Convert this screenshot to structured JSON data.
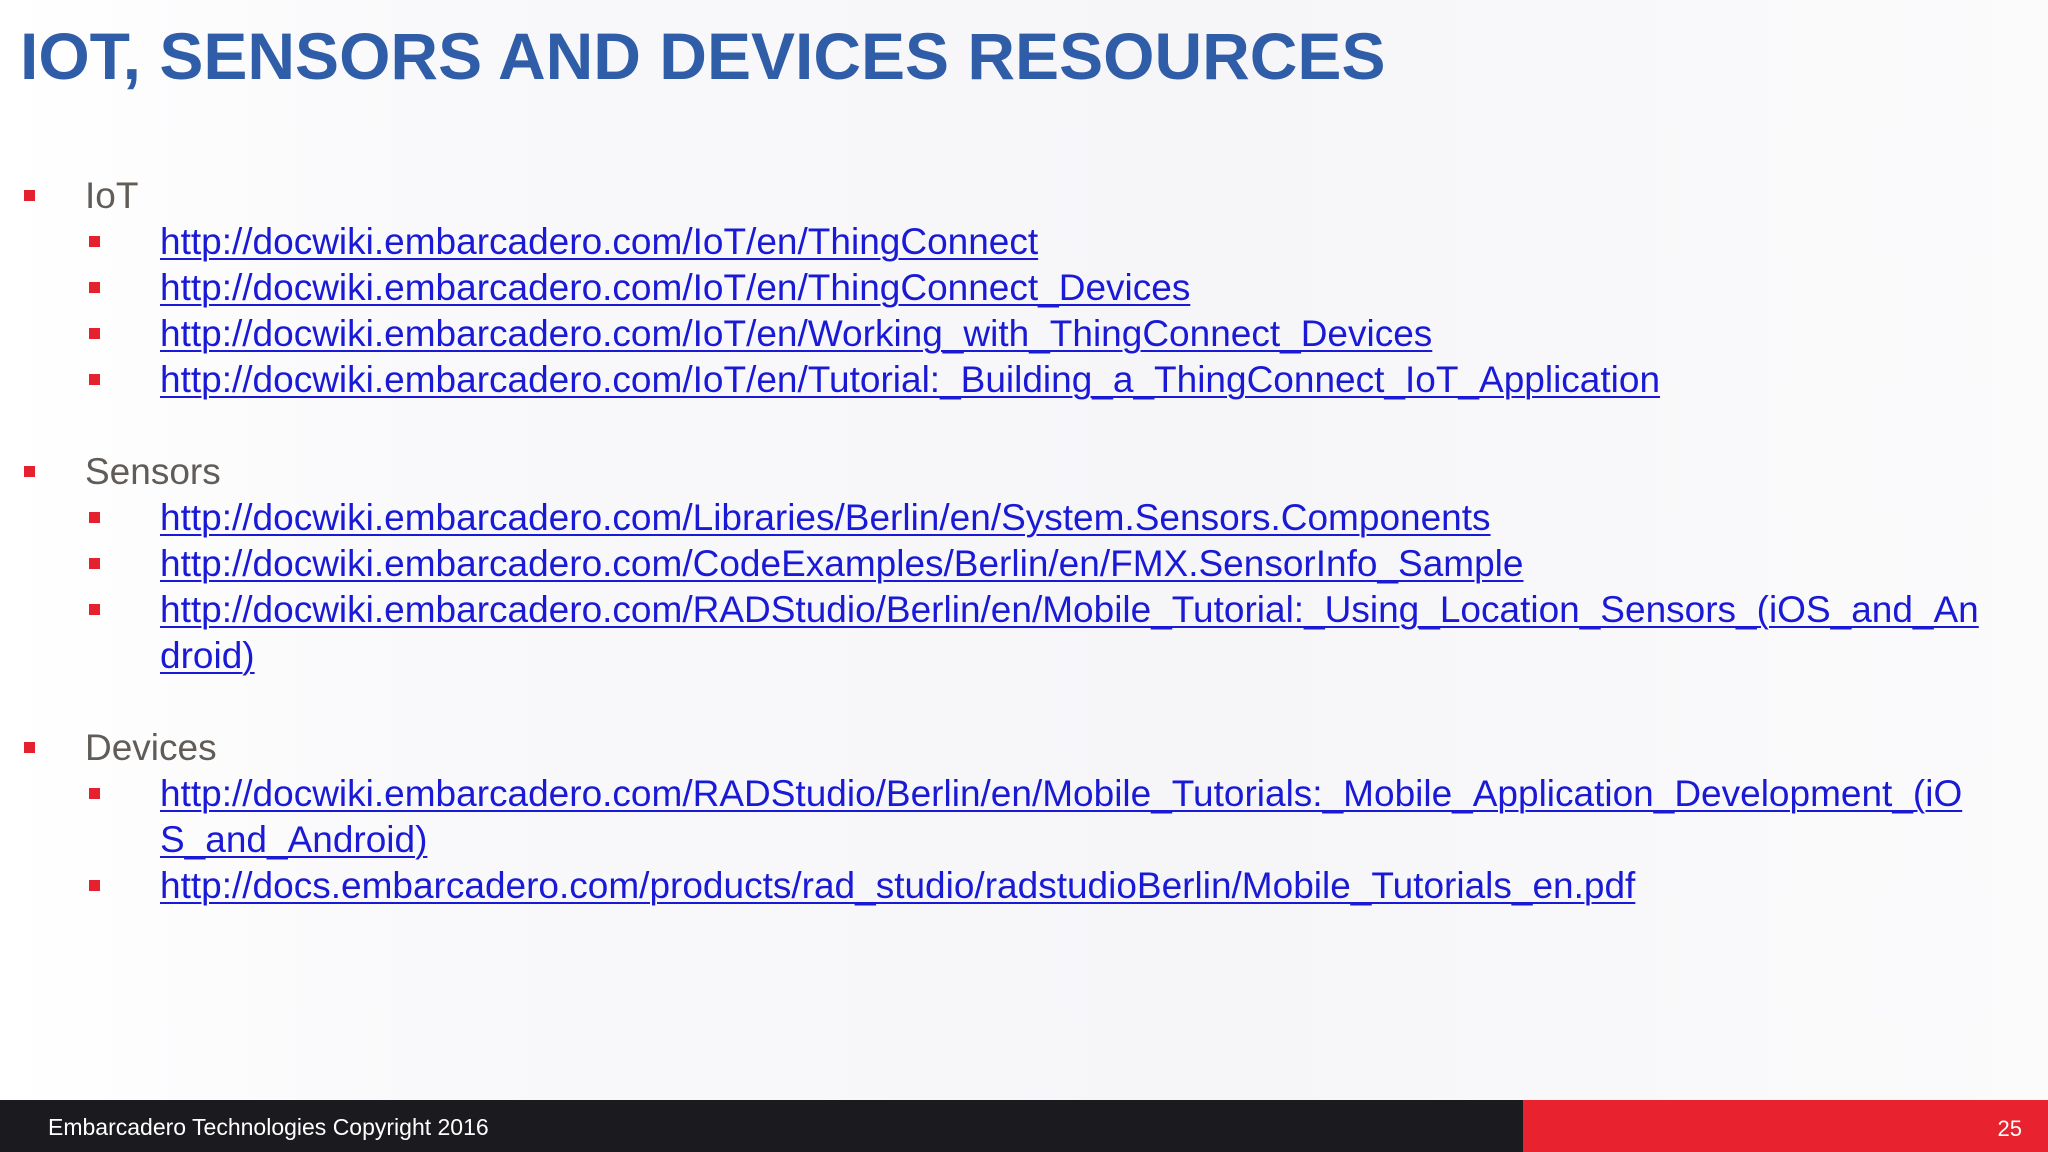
{
  "title": "IOT, SENSORS AND DEVICES RESOURCES",
  "sections": [
    {
      "heading": "IoT",
      "links": [
        "http://docwiki.embarcadero.com/IoT/en/ThingConnect",
        "http://docwiki.embarcadero.com/IoT/en/ThingConnect_Devices",
        "http://docwiki.embarcadero.com/IoT/en/Working_with_ThingConnect_Devices",
        "http://docwiki.embarcadero.com/IoT/en/Tutorial:_Building_a_ThingConnect_IoT_Application"
      ]
    },
    {
      "heading": "Sensors",
      "links": [
        "http://docwiki.embarcadero.com/Libraries/Berlin/en/System.Sensors.Components",
        "http://docwiki.embarcadero.com/CodeExamples/Berlin/en/FMX.SensorInfo_Sample",
        "http://docwiki.embarcadero.com/RADStudio/Berlin/en/Mobile_Tutorial:_Using_Location_Sensors_(iOS_and_Android)"
      ]
    },
    {
      "heading": "Devices",
      "links": [
        "http://docwiki.embarcadero.com/RADStudio/Berlin/en/Mobile_Tutorials:_Mobile_Application_Development_(iOS_and_Android)",
        "http://docs.embarcadero.com/products/rad_studio/radstudioBerlin/Mobile_Tutorials_en.pdf"
      ]
    }
  ],
  "footer": {
    "copyright": "Embarcadero Technologies Copyright 2016",
    "page_number": "25"
  },
  "colors": {
    "title": "#2f5da8",
    "link": "#1a1ad6",
    "bullet": "#e5202f",
    "footer_dark": "#1b1b1f",
    "footer_accent": "#e8232f"
  }
}
